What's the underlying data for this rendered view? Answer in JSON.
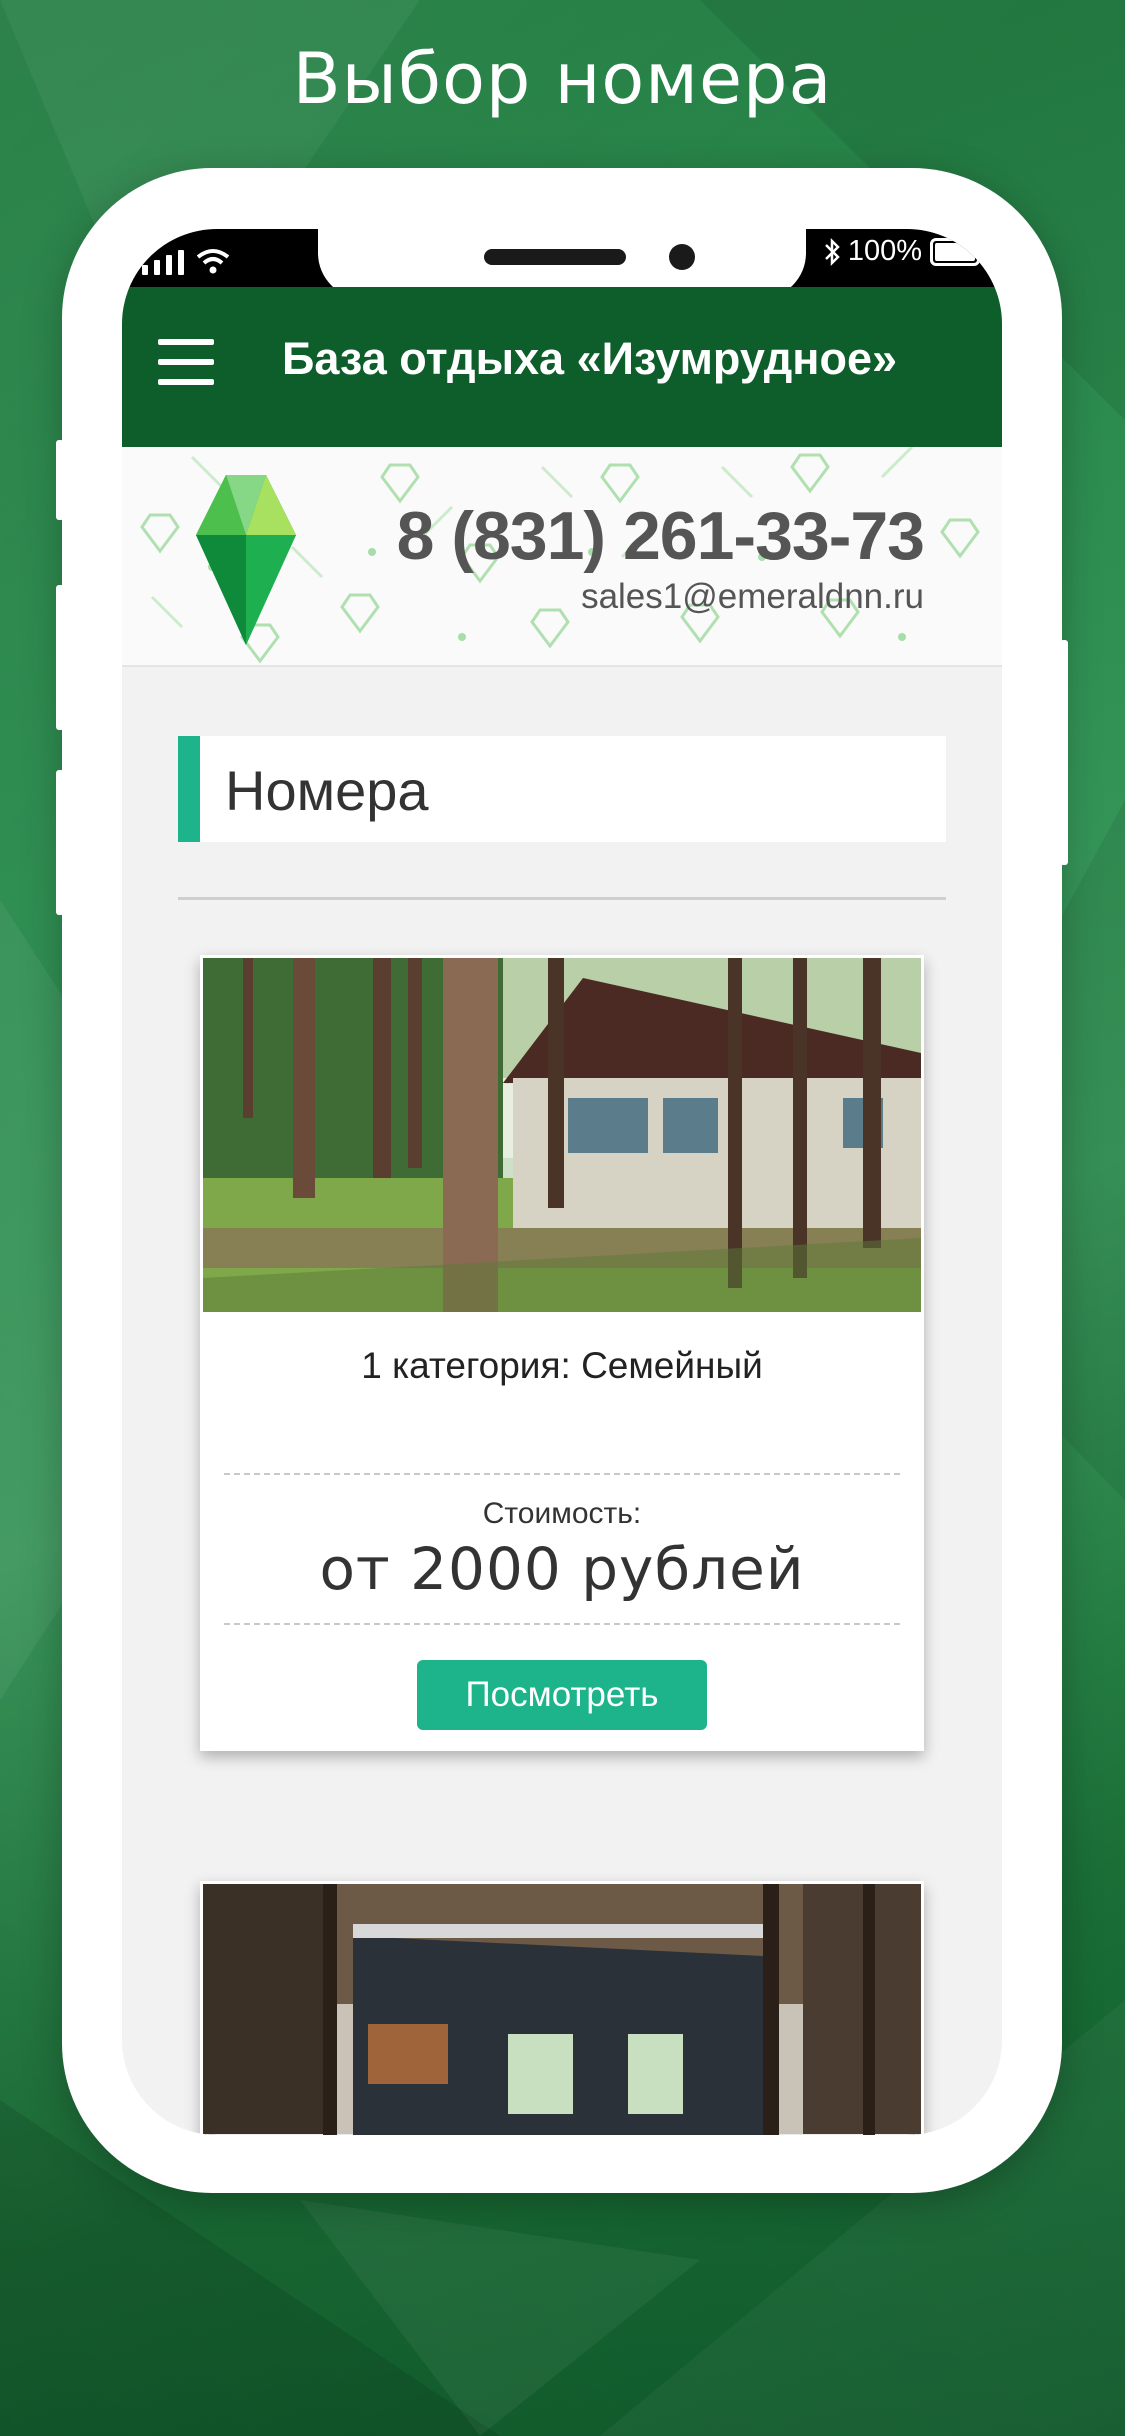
{
  "promo": {
    "title": "Выбор номера"
  },
  "status_bar": {
    "battery_text": "100%"
  },
  "app_bar": {
    "title": "База отдыха «Изумрудное»"
  },
  "contact": {
    "phone": "8 (831) 261-33-73",
    "email": "sales1@emeraldnn.ru"
  },
  "section": {
    "title": "Номера"
  },
  "rooms": [
    {
      "title": "1 категория: Семейный",
      "price_label": "Стоимость:",
      "price_value": "от 2000 рублей",
      "button_label": "Посмотреть"
    }
  ],
  "colors": {
    "app_bar": "#0e5e2b",
    "accent": "#1db38b",
    "background": "#2f8f52"
  }
}
